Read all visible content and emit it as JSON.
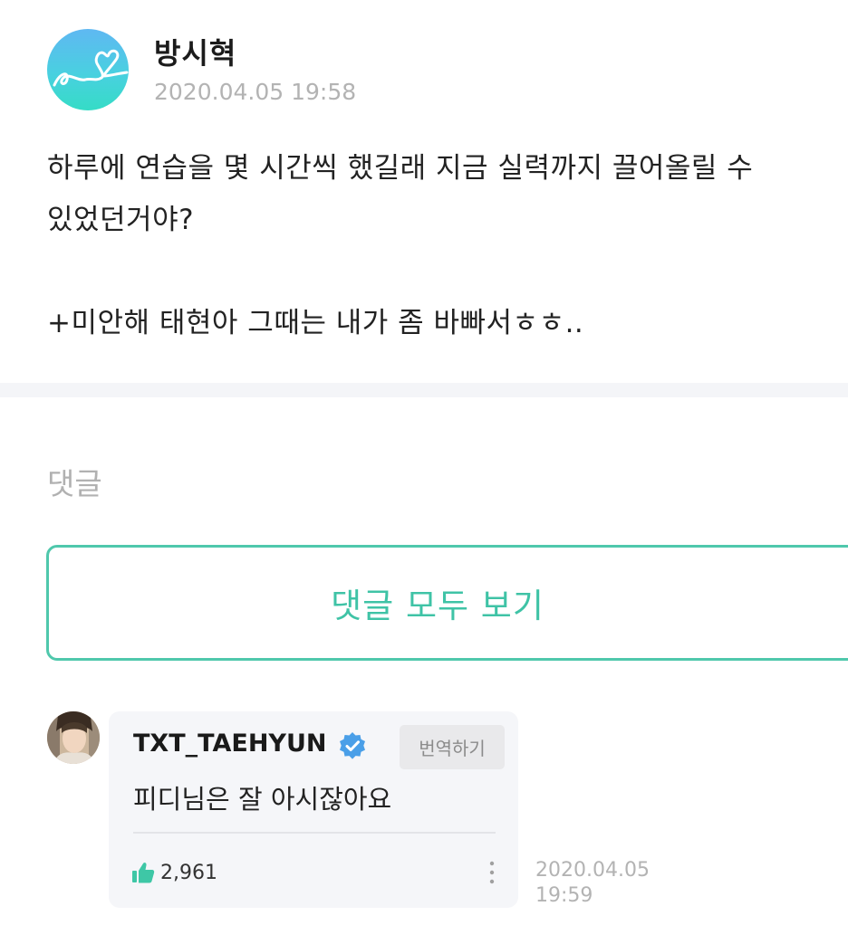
{
  "post": {
    "author": "방시혁",
    "date": "2020.04.05 19:58",
    "body": "하루에 연습을 몇 시간씩 했길래 지금 실력까지 끌어올릴 수\n있었던거야?\n\n+미안해 태현아 그때는 내가 좀 바빠서ㅎㅎ..",
    "avatar_icon": "heart-doodle-logo"
  },
  "comments_section": {
    "title": "댓글",
    "view_all_label": "댓글 모두 보기",
    "accent_color": "#3fc3a6"
  },
  "comment": {
    "author": "TXT_TAEHYUN",
    "verified_icon": "verified-badge-icon",
    "translate_label": "번역하기",
    "text": "피디님은 잘 아시잖아요",
    "like_icon": "thumbs-up-icon",
    "likes": "2,961",
    "more_icon": "vertical-ellipsis-icon",
    "time": "2020.04.05\n19:59"
  }
}
